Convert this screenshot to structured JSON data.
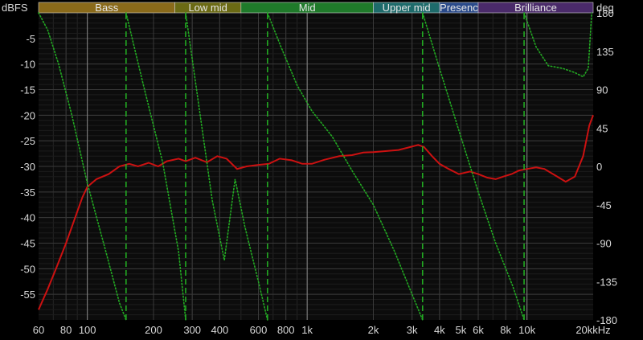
{
  "chart_data": {
    "type": "line",
    "left_unit": "dBFS",
    "right_unit": "deg",
    "x_unit_suffix": "kHz",
    "x_scale": "log",
    "x_range": [
      60,
      20000
    ],
    "y_left_range": [
      -60,
      0
    ],
    "y_right_range": [
      -180,
      180
    ],
    "grid": true,
    "x_ticks": [
      {
        "value": 60,
        "label": "60"
      },
      {
        "value": 80,
        "label": "80"
      },
      {
        "value": 100,
        "label": "100"
      },
      {
        "value": 200,
        "label": "200"
      },
      {
        "value": 300,
        "label": "300"
      },
      {
        "value": 400,
        "label": "400"
      },
      {
        "value": 600,
        "label": "600"
      },
      {
        "value": 800,
        "label": "800"
      },
      {
        "value": 1000,
        "label": "1k"
      },
      {
        "value": 2000,
        "label": "2k"
      },
      {
        "value": 3000,
        "label": "3k"
      },
      {
        "value": 4000,
        "label": "4k"
      },
      {
        "value": 5000,
        "label": "5k"
      },
      {
        "value": 6000,
        "label": "6k"
      },
      {
        "value": 8000,
        "label": "8k"
      },
      {
        "value": 10000,
        "label": "10k"
      },
      {
        "value": 20000,
        "label": "20k"
      }
    ],
    "y_left_ticks": [
      {
        "value": -5,
        "label": "-5"
      },
      {
        "value": -10,
        "label": "-10"
      },
      {
        "value": -15,
        "label": "-15"
      },
      {
        "value": -20,
        "label": "-20"
      },
      {
        "value": -25,
        "label": "-25"
      },
      {
        "value": -30,
        "label": "-30"
      },
      {
        "value": -35,
        "label": "-35"
      },
      {
        "value": -40,
        "label": "-40"
      },
      {
        "value": -45,
        "label": "-45"
      },
      {
        "value": -50,
        "label": "-50"
      },
      {
        "value": -55,
        "label": "-55"
      }
    ],
    "y_right_ticks": [
      {
        "value": 180,
        "label": "180"
      },
      {
        "value": 135,
        "label": "135"
      },
      {
        "value": 90,
        "label": "90"
      },
      {
        "value": 45,
        "label": "45"
      },
      {
        "value": 0,
        "label": "0"
      },
      {
        "value": -45,
        "label": "-45"
      },
      {
        "value": -90,
        "label": "-90"
      },
      {
        "value": -135,
        "label": "-135"
      },
      {
        "value": -180,
        "label": "-180"
      }
    ],
    "bands": [
      {
        "label": "Bass",
        "from": 60,
        "to": 250,
        "color": "#8a6a1a"
      },
      {
        "label": "Low mid",
        "from": 250,
        "to": 500,
        "color": "#6b6a14"
      },
      {
        "label": "Mid",
        "from": 500,
        "to": 2000,
        "color": "#1f7a2a"
      },
      {
        "label": "Upper mid",
        "from": 2000,
        "to": 4000,
        "color": "#1e6b6b"
      },
      {
        "label": "Presenc",
        "from": 4000,
        "to": 6000,
        "color": "#2a4a8a"
      },
      {
        "label": "Brilliance",
        "from": 6000,
        "to": 20000,
        "color": "#4a2a6a"
      }
    ],
    "series": [
      {
        "axis": "left",
        "color": "#cc1111",
        "points": [
          [
            60,
            -58
          ],
          [
            66,
            -54
          ],
          [
            72,
            -50
          ],
          [
            80,
            -45
          ],
          [
            88,
            -40
          ],
          [
            95,
            -36
          ],
          [
            100,
            -34
          ],
          [
            110,
            -32.5
          ],
          [
            125,
            -31.5
          ],
          [
            140,
            -30
          ],
          [
            155,
            -29.5
          ],
          [
            170,
            -30
          ],
          [
            190,
            -29.3
          ],
          [
            210,
            -30
          ],
          [
            230,
            -29
          ],
          [
            260,
            -28.5
          ],
          [
            280,
            -29
          ],
          [
            310,
            -28.3
          ],
          [
            350,
            -29.2
          ],
          [
            390,
            -28
          ],
          [
            430,
            -28.5
          ],
          [
            480,
            -30.5
          ],
          [
            530,
            -30
          ],
          [
            600,
            -29.7
          ],
          [
            670,
            -29.5
          ],
          [
            750,
            -28.5
          ],
          [
            850,
            -28.8
          ],
          [
            950,
            -29.5
          ],
          [
            1050,
            -29.5
          ],
          [
            1200,
            -28.7
          ],
          [
            1400,
            -28
          ],
          [
            1600,
            -27.8
          ],
          [
            1800,
            -27.3
          ],
          [
            2000,
            -27.2
          ],
          [
            2300,
            -27
          ],
          [
            2600,
            -26.8
          ],
          [
            2900,
            -26.3
          ],
          [
            3200,
            -25.8
          ],
          [
            3400,
            -26.2
          ],
          [
            3700,
            -28
          ],
          [
            4000,
            -29.5
          ],
          [
            4400,
            -30.5
          ],
          [
            4900,
            -31.5
          ],
          [
            5500,
            -31
          ],
          [
            6000,
            -31.5
          ],
          [
            6600,
            -32.2
          ],
          [
            7200,
            -32.5
          ],
          [
            7800,
            -32
          ],
          [
            8500,
            -31.5
          ],
          [
            9200,
            -30.8
          ],
          [
            10000,
            -30.5
          ],
          [
            11000,
            -30.2
          ],
          [
            12000,
            -30.5
          ],
          [
            13500,
            -31.8
          ],
          [
            15000,
            -33
          ],
          [
            16500,
            -32
          ],
          [
            18000,
            -28
          ],
          [
            19200,
            -22
          ],
          [
            20000,
            -20
          ]
        ]
      },
      {
        "axis": "right",
        "color": "#22aa22",
        "style": "dotted",
        "points": [
          [
            60,
            180
          ],
          [
            66,
            160
          ],
          [
            74,
            120
          ],
          [
            85,
            60
          ],
          [
            100,
            -20
          ],
          [
            120,
            -95
          ],
          [
            140,
            -160
          ],
          [
            150,
            -180
          ],
          [
            150,
            180
          ],
          [
            180,
            95
          ],
          [
            220,
            5
          ],
          [
            260,
            -100
          ],
          [
            280,
            -180
          ],
          [
            280,
            180
          ],
          [
            320,
            75
          ],
          [
            370,
            -40
          ],
          [
            420,
            -110
          ],
          [
            470,
            -15
          ],
          [
            520,
            -70
          ],
          [
            600,
            -135
          ],
          [
            660,
            -180
          ],
          [
            660,
            180
          ],
          [
            760,
            140
          ],
          [
            900,
            95
          ],
          [
            1050,
            65
          ],
          [
            1300,
            35
          ],
          [
            1600,
            -5
          ],
          [
            2000,
            -45
          ],
          [
            2500,
            -100
          ],
          [
            3000,
            -150
          ],
          [
            3350,
            -180
          ],
          [
            3350,
            180
          ],
          [
            4000,
            115
          ],
          [
            5000,
            35
          ],
          [
            6000,
            -30
          ],
          [
            7200,
            -90
          ],
          [
            8600,
            -140
          ],
          [
            9700,
            -180
          ],
          [
            9700,
            180
          ],
          [
            11000,
            140
          ],
          [
            12500,
            118
          ],
          [
            14500,
            115
          ],
          [
            16500,
            110
          ],
          [
            18000,
            105
          ],
          [
            19000,
            115
          ],
          [
            19700,
            180
          ]
        ]
      }
    ]
  }
}
